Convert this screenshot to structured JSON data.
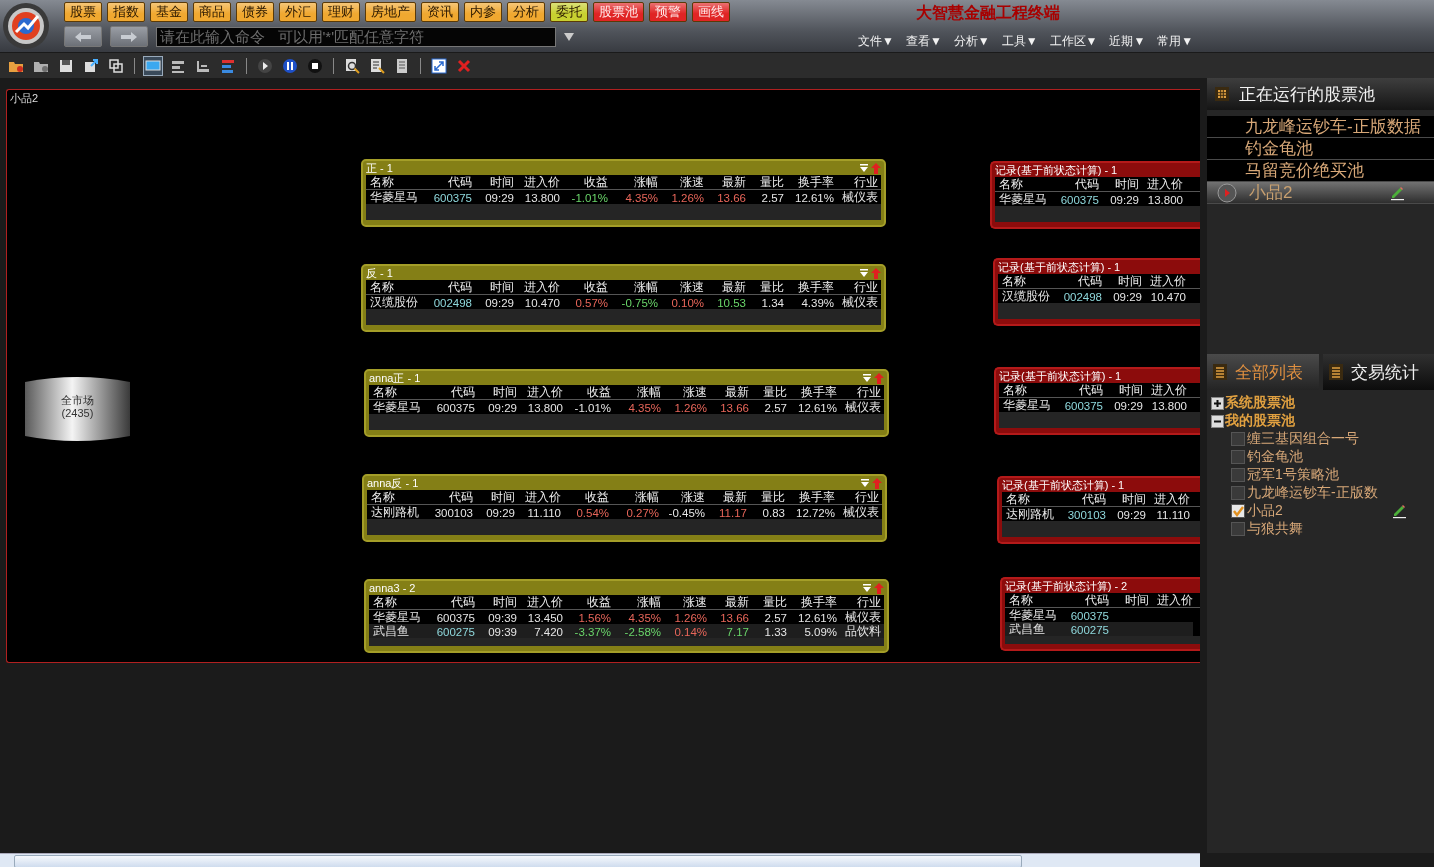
{
  "nav_buttons": [
    {
      "label": "股票",
      "color": "#f0a830"
    },
    {
      "label": "指数",
      "color": "#f0a830"
    },
    {
      "label": "基金",
      "color": "#f0a830"
    },
    {
      "label": "商品",
      "color": "#f0a830"
    },
    {
      "label": "债券",
      "color": "#f0a830"
    },
    {
      "label": "外汇",
      "color": "#f0a830"
    },
    {
      "label": "理财",
      "color": "#f0a830"
    },
    {
      "label": "房地产",
      "color": "#f0a830"
    },
    {
      "label": "资讯",
      "color": "#f0a830"
    },
    {
      "label": "内参",
      "color": "#f0a830"
    },
    {
      "label": "分析",
      "color": "#f0a830"
    },
    {
      "label": "委托",
      "color": "#c8d030"
    },
    {
      "label": "股票池",
      "color": "#e02424"
    },
    {
      "label": "预警",
      "color": "#e02424"
    },
    {
      "label": "画线",
      "color": "#e02424"
    }
  ],
  "command": {
    "placeholder": "请在此输入命令   可以用'*'匹配任意字符"
  },
  "title": "大智慧金融工程终端",
  "menu": [
    "文件▼",
    "查看▼",
    "分析▼",
    "工具▼",
    "工作区▼",
    "近期▼",
    "常用▼"
  ],
  "layout_buttons": [
    {
      "selected": true
    },
    {
      "selected": false
    },
    {
      "selected": false
    },
    {
      "selected": false
    }
  ],
  "canvas": {
    "frame_label": "小品2",
    "source": {
      "label": "全市场",
      "count": "(2435)"
    },
    "filters": [
      {
        "title": "正 - 1",
        "columns": [
          "名称",
          "代码",
          "时间",
          "进入价",
          "收益",
          "涨幅",
          "涨速",
          "最新",
          "量比",
          "换手率",
          "行业"
        ],
        "rows": [
          {
            "cells": [
              {
                "text": "华菱星马",
                "kind": "flat"
              },
              {
                "text": "600375",
                "kind": "code"
              },
              {
                "text": "09:29",
                "kind": "flat"
              },
              {
                "text": "13.800",
                "kind": "flat"
              },
              {
                "text": "-1.01%",
                "kind": "fall"
              },
              {
                "text": "4.35%",
                "kind": "rise"
              },
              {
                "text": "1.26%",
                "kind": "rise"
              },
              {
                "text": "13.66",
                "kind": "rise"
              },
              {
                "text": "2.57",
                "kind": "flat"
              },
              {
                "text": "12.61%",
                "kind": "flat"
              },
              {
                "text": "械仪表",
                "kind": "flat"
              }
            ]
          }
        ]
      },
      {
        "title": "反 - 1",
        "columns": [
          "名称",
          "代码",
          "时间",
          "进入价",
          "收益",
          "涨幅",
          "涨速",
          "最新",
          "量比",
          "换手率",
          "行业"
        ],
        "rows": [
          {
            "cells": [
              {
                "text": "汉缆股份",
                "kind": "flat"
              },
              {
                "text": "002498",
                "kind": "code"
              },
              {
                "text": "09:29",
                "kind": "flat"
              },
              {
                "text": "10.470",
                "kind": "flat"
              },
              {
                "text": "0.57%",
                "kind": "rise"
              },
              {
                "text": "-0.75%",
                "kind": "fall"
              },
              {
                "text": "0.10%",
                "kind": "rise"
              },
              {
                "text": "10.53",
                "kind": "fall"
              },
              {
                "text": "1.34",
                "kind": "flat"
              },
              {
                "text": "4.39%",
                "kind": "flat"
              },
              {
                "text": "械仪表",
                "kind": "flat"
              }
            ]
          }
        ]
      },
      {
        "title": "anna正 - 1",
        "columns": [
          "名称",
          "代码",
          "时间",
          "进入价",
          "收益",
          "涨幅",
          "涨速",
          "最新",
          "量比",
          "换手率",
          "行业"
        ],
        "rows": [
          {
            "cells": [
              {
                "text": "华菱星马",
                "kind": "flat"
              },
              {
                "text": "600375",
                "kind": "flat"
              },
              {
                "text": "09:29",
                "kind": "flat"
              },
              {
                "text": "13.800",
                "kind": "flat"
              },
              {
                "text": "-1.01%",
                "kind": "flat"
              },
              {
                "text": "4.35%",
                "kind": "rise"
              },
              {
                "text": "1.26%",
                "kind": "rise"
              },
              {
                "text": "13.66",
                "kind": "rise"
              },
              {
                "text": "2.57",
                "kind": "flat"
              },
              {
                "text": "12.61%",
                "kind": "flat"
              },
              {
                "text": "械仪表",
                "kind": "flat"
              }
            ]
          }
        ]
      },
      {
        "title": "anna反 - 1",
        "columns": [
          "名称",
          "代码",
          "时间",
          "进入价",
          "收益",
          "涨幅",
          "涨速",
          "最新",
          "量比",
          "换手率",
          "行业"
        ],
        "rows": [
          {
            "cells": [
              {
                "text": "达刚路机",
                "kind": "flat"
              },
              {
                "text": "300103",
                "kind": "flat"
              },
              {
                "text": "09:29",
                "kind": "flat"
              },
              {
                "text": "11.110",
                "kind": "flat"
              },
              {
                "text": "0.54%",
                "kind": "rise"
              },
              {
                "text": "0.27%",
                "kind": "rise"
              },
              {
                "text": "-0.45%",
                "kind": "flat"
              },
              {
                "text": "11.17",
                "kind": "rise"
              },
              {
                "text": "0.83",
                "kind": "flat"
              },
              {
                "text": "12.72%",
                "kind": "flat"
              },
              {
                "text": "械仪表",
                "kind": "flat"
              }
            ]
          }
        ]
      },
      {
        "title": "anna3 - 2",
        "columns": [
          "名称",
          "代码",
          "时间",
          "进入价",
          "收益",
          "涨幅",
          "涨速",
          "最新",
          "量比",
          "换手率",
          "行业"
        ],
        "rows": [
          {
            "cells": [
              {
                "text": "华菱星马",
                "kind": "flat"
              },
              {
                "text": "600375",
                "kind": "flat"
              },
              {
                "text": "09:39",
                "kind": "flat"
              },
              {
                "text": "13.450",
                "kind": "flat"
              },
              {
                "text": "1.56%",
                "kind": "rise"
              },
              {
                "text": "4.35%",
                "kind": "rise"
              },
              {
                "text": "1.26%",
                "kind": "rise"
              },
              {
                "text": "13.66",
                "kind": "rise"
              },
              {
                "text": "2.57",
                "kind": "flat"
              },
              {
                "text": "12.61%",
                "kind": "flat"
              },
              {
                "text": "械仪表",
                "kind": "flat"
              }
            ]
          },
          {
            "cells": [
              {
                "text": "武昌鱼",
                "kind": "flat"
              },
              {
                "text": "600275",
                "kind": "code"
              },
              {
                "text": "09:39",
                "kind": "flat"
              },
              {
                "text": "7.420",
                "kind": "flat"
              },
              {
                "text": "-3.37%",
                "kind": "fall"
              },
              {
                "text": "-2.58%",
                "kind": "fall"
              },
              {
                "text": "0.14%",
                "kind": "rise"
              },
              {
                "text": "7.17",
                "kind": "fall"
              },
              {
                "text": "1.33",
                "kind": "flat"
              },
              {
                "text": "5.09%",
                "kind": "flat"
              },
              {
                "text": "品饮料",
                "kind": "flat"
              }
            ]
          }
        ]
      }
    ],
    "records": [
      {
        "title": "记录(基于前状态计算) - 1",
        "columns": [
          "名称",
          "代码",
          "时间",
          "进入价"
        ],
        "rows": [
          {
            "cells": [
              {
                "text": "华菱星马",
                "kind": "flat"
              },
              {
                "text": "600375",
                "kind": "code"
              },
              {
                "text": "09:29",
                "kind": "flat"
              },
              {
                "text": "13.800",
                "kind": "flat"
              }
            ]
          }
        ]
      },
      {
        "title": "记录(基于前状态计算) - 1",
        "columns": [
          "名称",
          "代码",
          "时间",
          "进入价"
        ],
        "rows": [
          {
            "cells": [
              {
                "text": "汉缆股份",
                "kind": "flat"
              },
              {
                "text": "002498",
                "kind": "code"
              },
              {
                "text": "09:29",
                "kind": "flat"
              },
              {
                "text": "10.470",
                "kind": "flat"
              }
            ]
          }
        ]
      },
      {
        "title": "记录(基于前状态计算) - 1",
        "columns": [
          "名称",
          "代码",
          "时间",
          "进入价"
        ],
        "rows": [
          {
            "cells": [
              {
                "text": "华菱星马",
                "kind": "flat"
              },
              {
                "text": "600375",
                "kind": "code"
              },
              {
                "text": "09:29",
                "kind": "flat"
              },
              {
                "text": "13.800",
                "kind": "flat"
              }
            ]
          }
        ]
      },
      {
        "title": "记录(基于前状态计算) - 1",
        "columns": [
          "名称",
          "代码",
          "时间",
          "进入价"
        ],
        "rows": [
          {
            "cells": [
              {
                "text": "达刚路机",
                "kind": "flat"
              },
              {
                "text": "300103",
                "kind": "code"
              },
              {
                "text": "09:29",
                "kind": "flat"
              },
              {
                "text": "11.110",
                "kind": "flat"
              }
            ]
          }
        ]
      },
      {
        "title": "记录(基于前状态计算) - 2",
        "columns": [
          "名称",
          "代码",
          "时间",
          "进入价"
        ],
        "rows": [
          {
            "cells": [
              {
                "text": "华菱星马",
                "kind": "flat"
              },
              {
                "text": "600375",
                "kind": "code"
              }
            ]
          },
          {
            "cells": [
              {
                "text": "武昌鱼",
                "kind": "flat"
              },
              {
                "text": "600275",
                "kind": "code"
              }
            ]
          }
        ]
      }
    ]
  },
  "running_pools": {
    "title": "正在运行的股票池",
    "items": [
      {
        "label": "九龙峰运钞车-正版数据",
        "selected": false
      },
      {
        "label": "钓金龟池",
        "selected": false
      },
      {
        "label": "马留竞价绝买池",
        "selected": false
      },
      {
        "label": "小品2",
        "selected": true
      }
    ]
  },
  "pool_tabs": [
    {
      "label": "全部列表",
      "selected": true
    },
    {
      "label": "交易统计",
      "selected": false
    }
  ],
  "pool_tree": [
    {
      "label": "系统股票池",
      "expanded": false
    },
    {
      "label": "我的股票池",
      "expanded": true,
      "children": [
        {
          "label": "缠三基因组合一号",
          "checked": false
        },
        {
          "label": "钓金龟池",
          "checked": false
        },
        {
          "label": "冠军1号策略池",
          "checked": false
        },
        {
          "label": "九龙峰运钞车-正版数",
          "checked": false
        },
        {
          "label": "小品2",
          "checked": true
        },
        {
          "label": "与狼共舞",
          "checked": false
        }
      ]
    }
  ]
}
